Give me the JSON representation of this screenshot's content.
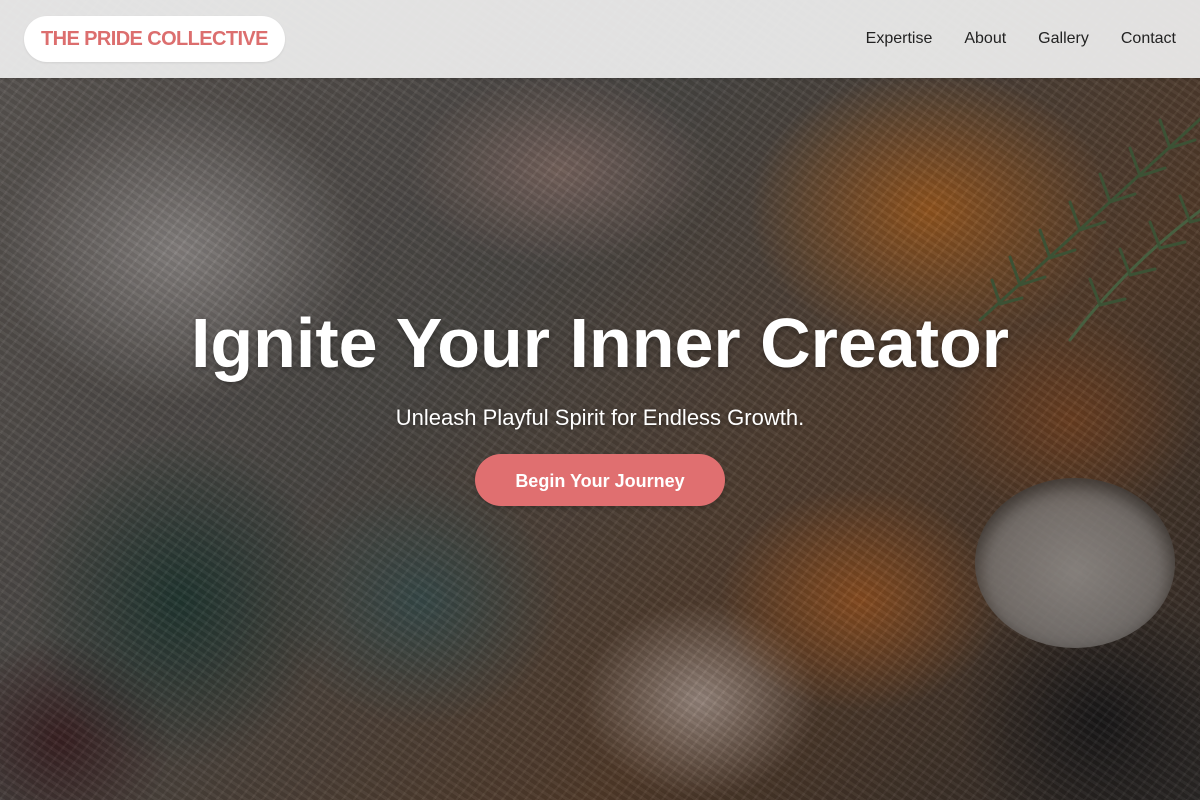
{
  "brand": {
    "name": "THE PRIDE COLLECTIVE",
    "color": "#dc6e6e"
  },
  "nav": {
    "links": [
      {
        "label": "Expertise"
      },
      {
        "label": "About"
      },
      {
        "label": "Gallery"
      },
      {
        "label": "Contact"
      }
    ]
  },
  "hero": {
    "title": "Ignite Your Inner Creator",
    "subtitle": "Unleash Playful Spirit for Endless Growth.",
    "cta_label": "Begin Your Journey",
    "cta_color": "#e06f70",
    "background_image": "textured-oil-paint-palette"
  }
}
